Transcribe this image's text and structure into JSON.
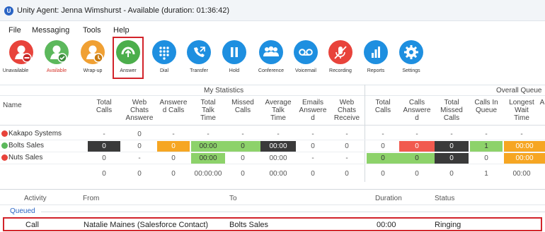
{
  "window": {
    "title": "Unity Agent: Jenna Wimshurst - Available (duration: 01:36:42)"
  },
  "menu": [
    "File",
    "Messaging",
    "Tools",
    "Help"
  ],
  "toolbar": [
    {
      "label": "Unavailable",
      "icon": "person-unavailable-icon",
      "color": "#e8433b"
    },
    {
      "label": "Available",
      "icon": "person-available-icon",
      "color": "#5cb85c"
    },
    {
      "label": "Wrap-up",
      "icon": "person-wrapup-icon",
      "color": "#f0a033"
    },
    {
      "label": "Answer",
      "icon": "answer-phone-icon",
      "color": "#4cae4c"
    },
    {
      "label": "Dial",
      "icon": "dialpad-icon",
      "color": "#1e8fe0"
    },
    {
      "label": "Transfer",
      "icon": "transfer-icon",
      "color": "#1e8fe0"
    },
    {
      "label": "Hold",
      "icon": "hold-icon",
      "color": "#1e8fe0"
    },
    {
      "label": "Conference",
      "icon": "conference-icon",
      "color": "#1e8fe0"
    },
    {
      "label": "Voicemail",
      "icon": "voicemail-icon",
      "color": "#1e8fe0"
    },
    {
      "label": "Recording",
      "icon": "recording-icon",
      "color": "#e8433b"
    },
    {
      "label": "Reports",
      "icon": "reports-icon",
      "color": "#1e8fe0"
    },
    {
      "label": "Settings",
      "icon": "settings-icon",
      "color": "#1e8fe0"
    }
  ],
  "grid": {
    "group_my_stats": "My Statistics",
    "group_overall": "Overall Queue",
    "columns": [
      "Name",
      "Total\nCalls",
      "Web\nChats\nAnswere",
      "Answere\nd Calls",
      "Total\nTalk\nTime",
      "Missed\nCalls",
      "Average\nTalk\nTime",
      "Emails\nAnswere\nd",
      "Web\nChats\nReceive",
      "Total\nCalls",
      "Calls\nAnswere\nd",
      "Total\nMissed\nCalls",
      "Calls In\nQueue",
      "Longest\nWait\nTime",
      "A"
    ],
    "rows": [
      {
        "name": "Kakapo Systems",
        "status_color": "#e8433b",
        "cells": [
          "-",
          "0",
          "-",
          "-",
          "-",
          "-",
          "-",
          "-",
          "-",
          "-",
          "-",
          "-",
          "-",
          ""
        ]
      },
      {
        "name": "Bolts Sales",
        "status_color": "#5cb85c",
        "cells": [
          "0",
          "0",
          "0",
          "00:00",
          "0",
          "00:00",
          "0",
          "0",
          "0",
          "0",
          "0",
          "1",
          "00:00",
          ""
        ]
      },
      {
        "name": "Nuts Sales",
        "status_color": "#e8433b",
        "cells": [
          "0",
          "-",
          "0",
          "00:00",
          "0",
          "00:00",
          "-",
          "-",
          "0",
          "0",
          "0",
          "0",
          "00:00",
          ""
        ]
      }
    ],
    "totals": [
      "0",
      "0",
      "0",
      "00:00:00",
      "0",
      "00:00",
      "0",
      "0",
      "0",
      "0",
      "0",
      "1",
      "00:00",
      ""
    ]
  },
  "activity": {
    "headers": [
      "Activity",
      "From",
      "To",
      "Duration",
      "Status"
    ],
    "group": "Queued",
    "rows": [
      {
        "activity": "Call",
        "from": "Natalie Maines (Salesforce Contact)",
        "to": "Bolts Sales",
        "duration": "00:00",
        "status": "Ringing"
      }
    ]
  }
}
